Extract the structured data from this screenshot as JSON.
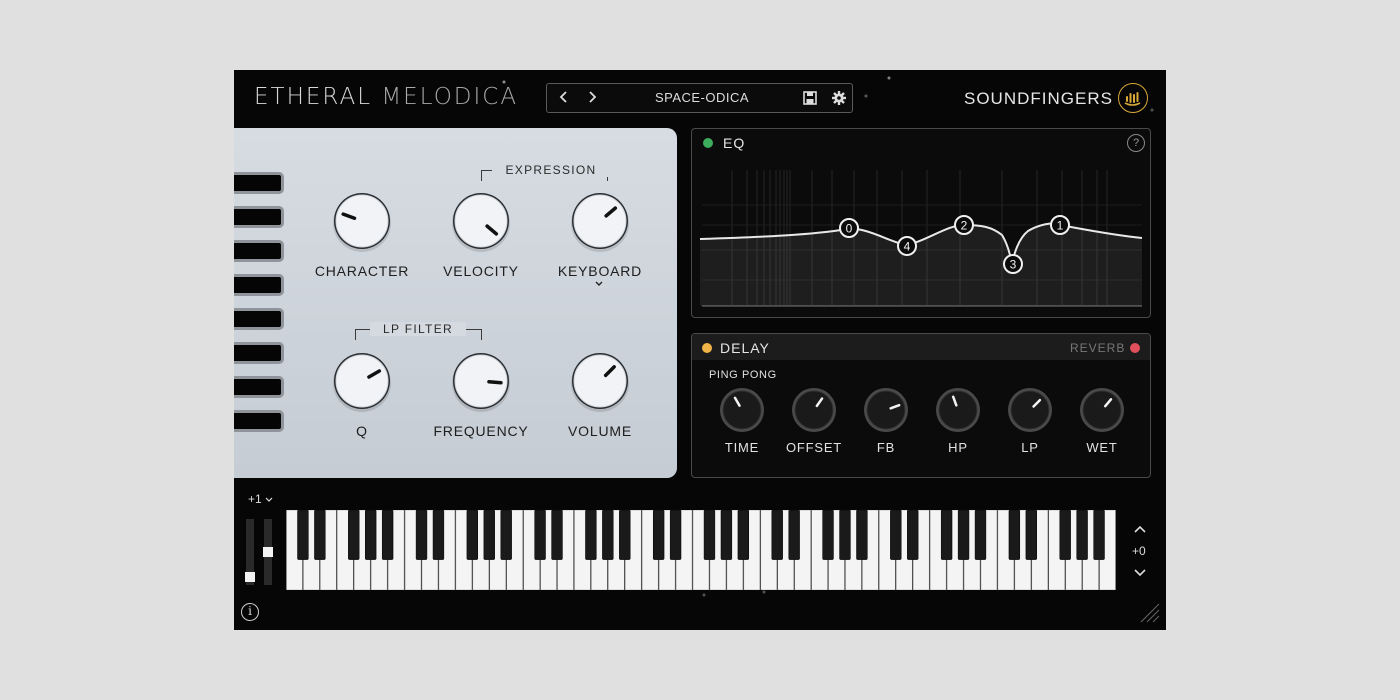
{
  "header": {
    "title_word1": "ETHERAL",
    "title_word2": "MELODICA",
    "preset_name": "SPACE-ODICA",
    "brand": "SOUNDFINGERS"
  },
  "main": {
    "expression_label": "EXPRESSION",
    "lp_filter_label": "LP FILTER",
    "knobs": [
      {
        "label": "CHARACTER",
        "angle": -70
      },
      {
        "label": "VELOCITY",
        "angle": 130
      },
      {
        "label": "KEYBOARD",
        "angle": 50
      },
      {
        "label": "Q",
        "angle": 60
      },
      {
        "label": "FREQUENCY",
        "angle": 95
      },
      {
        "label": "VOLUME",
        "angle": 45
      }
    ],
    "drawbar_count": 8
  },
  "eq": {
    "label": "EQ",
    "enabled_color": "#3cab5b",
    "bands": [
      {
        "label": "0"
      },
      {
        "label": "4"
      },
      {
        "label": "2"
      },
      {
        "label": "3"
      },
      {
        "label": "1"
      }
    ]
  },
  "delay": {
    "label": "DELAY",
    "delay_dot_color": "#f0b348",
    "reverb_label": "REVERB",
    "reverb_dot_color": "#e0505a",
    "mode": "PING PONG",
    "knobs": [
      {
        "label": "TIME",
        "angle": -30
      },
      {
        "label": "OFFSET",
        "angle": 35
      },
      {
        "label": "FB",
        "angle": 70
      },
      {
        "label": "HP",
        "angle": -20
      },
      {
        "label": "LP",
        "angle": 45
      },
      {
        "label": "WET",
        "angle": 40
      }
    ]
  },
  "keyboard": {
    "octave": "+1",
    "transpose": "+0",
    "white_keys": 49,
    "mod_level": 0.05,
    "pitch_level": 0.5
  }
}
